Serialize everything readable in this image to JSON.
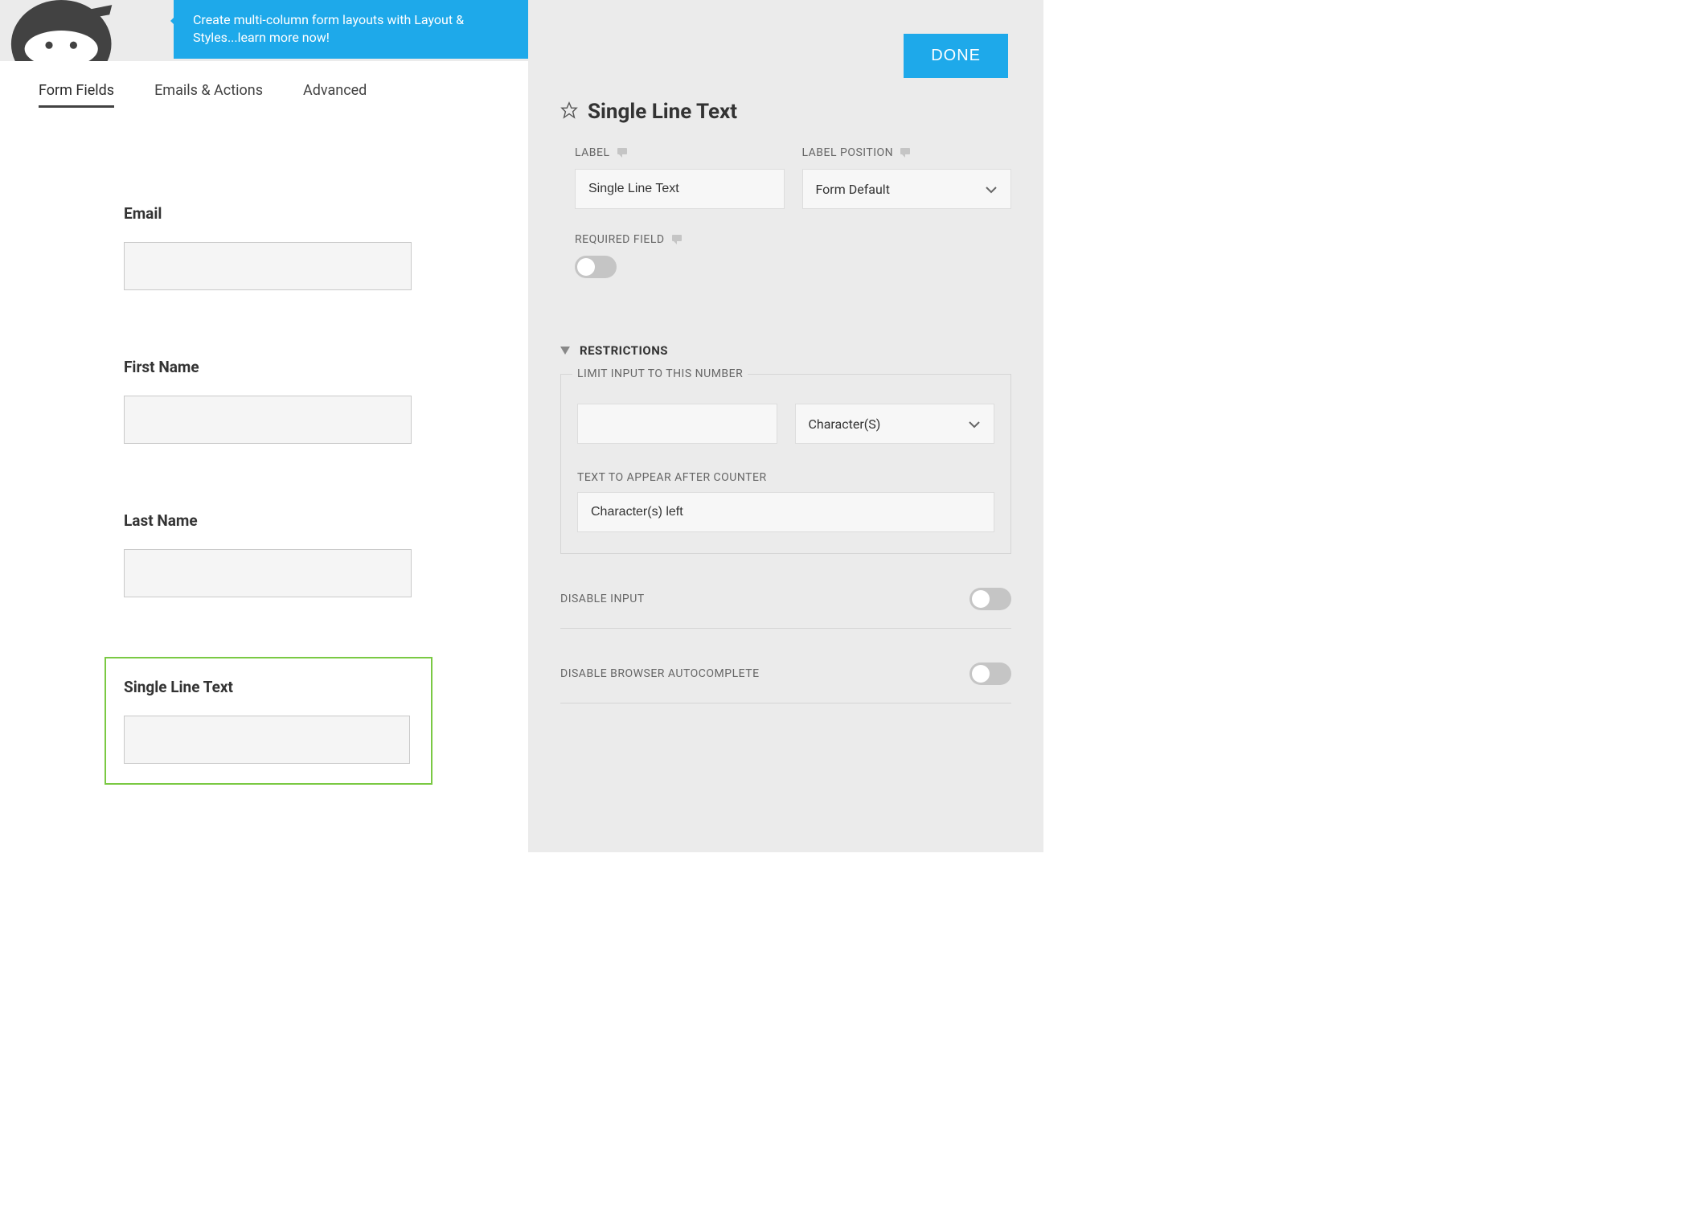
{
  "header": {
    "promo": "Create multi-column form layouts with Layout & Styles...learn more now!"
  },
  "tabs": [
    "Form Fields",
    "Emails & Actions",
    "Advanced"
  ],
  "fields": [
    {
      "label": "Email",
      "selected": false
    },
    {
      "label": "First Name",
      "selected": false
    },
    {
      "label": "Last Name",
      "selected": false
    },
    {
      "label": "Single Line Text",
      "selected": true
    }
  ],
  "done_button": "DONE",
  "panel": {
    "title": "Single Line Text",
    "settings": {
      "label_heading": "LABEL",
      "label_value": "Single Line Text",
      "position_heading": "LABEL POSITION",
      "position_value": "Form Default",
      "required_heading": "REQUIRED FIELD"
    },
    "restrictions": {
      "heading": "RESTRICTIONS",
      "limit_label": "LIMIT INPUT TO THIS NUMBER",
      "limit_value": "",
      "limit_unit": "Character(S)",
      "counter_label": "TEXT TO APPEAR AFTER COUNTER",
      "counter_value": "Character(s) left"
    },
    "toggles": {
      "disable_input": "DISABLE INPUT",
      "disable_autocomplete": "DISABLE BROWSER AUTOCOMPLETE"
    }
  }
}
